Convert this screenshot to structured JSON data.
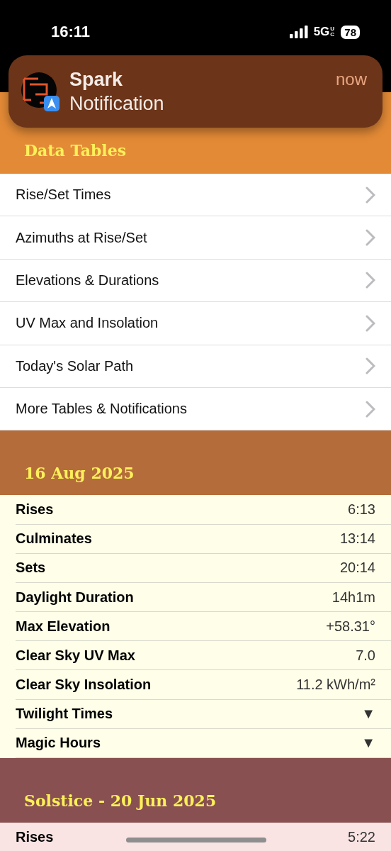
{
  "status_bar": {
    "time": "16:11",
    "network": "5G",
    "network_sub": "UC",
    "battery": "78"
  },
  "notification": {
    "app": "Spark",
    "message": "Notification",
    "time": "now"
  },
  "data_tables": {
    "title": "Data Tables",
    "color": "#e38a36",
    "items": [
      {
        "label": "Rise/Set Times"
      },
      {
        "label": "Azimuths at Rise/Set"
      },
      {
        "label": "Elevations & Durations"
      },
      {
        "label": "UV Max and Insolation"
      },
      {
        "label": "Today's Solar Path"
      },
      {
        "label": "More Tables & Notifications"
      }
    ]
  },
  "sections": [
    {
      "title": "16 Aug 2025",
      "color": "#b46c3a",
      "table": {
        "color": "#fffee8",
        "rows": [
          {
            "label": "Rises",
            "value": "6:13"
          },
          {
            "label": "Culminates",
            "value": "13:14"
          },
          {
            "label": "Sets",
            "value": "20:14"
          },
          {
            "label": "Daylight Duration",
            "value": "14h1m"
          },
          {
            "label": "Max Elevation",
            "value": "+58.31°"
          },
          {
            "label": "Clear Sky UV Max",
            "value": "7.0"
          },
          {
            "label": "Clear Sky Insolation",
            "value": "11.2 kWh/m²"
          },
          {
            "label": "Twilight Times",
            "value": "▼"
          },
          {
            "label": "Magic Hours",
            "value": "▼"
          }
        ]
      }
    },
    {
      "title": "Solstice - 20 Jun 2025",
      "color": "#885050",
      "table": {
        "color": "#f9e3e3",
        "rows": [
          {
            "label": "Rises",
            "value": "5:22"
          }
        ]
      }
    }
  ]
}
